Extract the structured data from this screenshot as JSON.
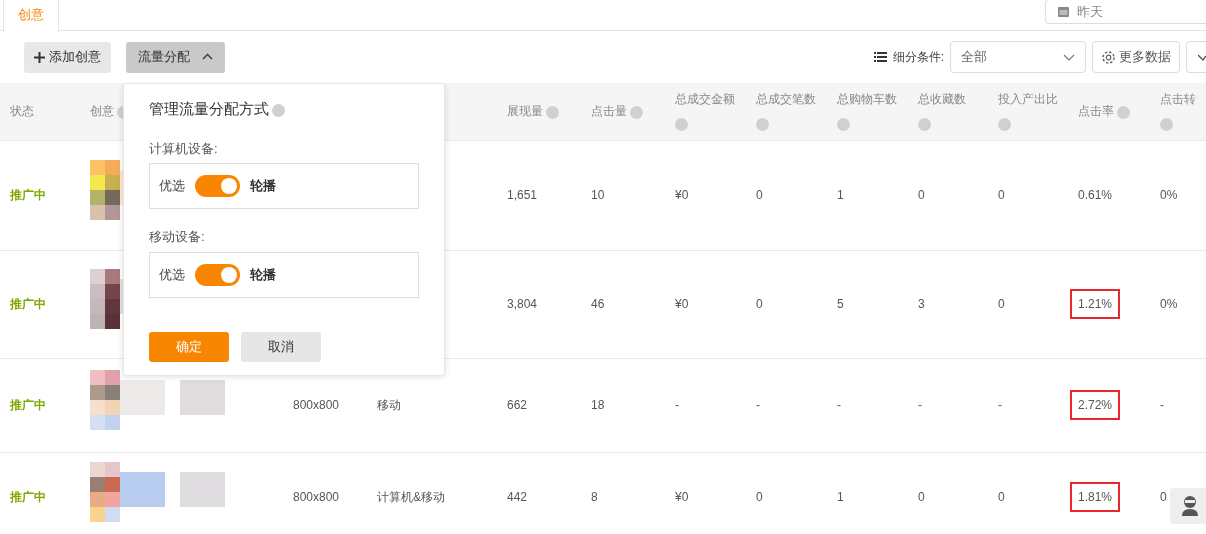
{
  "tabs": [
    {
      "label": "创意",
      "selected": true
    }
  ],
  "date_field": {
    "placeholder": "昨天"
  },
  "toolbar": {
    "add_button": "添加创意",
    "traffic_button": {
      "label": "流量分配",
      "expanded": true
    },
    "segment_label": "细分条件:",
    "segment_select": {
      "value": "全部"
    },
    "more_button": "更多数据"
  },
  "table": {
    "columns": [
      {
        "label": "状态",
        "help": false
      },
      {
        "label": "创意",
        "help": true
      },
      {},
      {},
      {
        "label": "展现量",
        "help": true
      },
      {
        "label": "点击量",
        "help": true
      },
      {
        "label": "总成交金额",
        "help": true
      },
      {
        "label": "总成交笔数",
        "help": true
      },
      {
        "label": "总购物车数",
        "help": true
      },
      {
        "label": "总收藏数",
        "help": true
      },
      {
        "label": "投入产出比",
        "help": true
      },
      {
        "label": "点击率",
        "help": true
      },
      {
        "label": "点击转",
        "help": true
      }
    ],
    "rows": [
      {
        "status": "推广中",
        "metrics": [
          {
            "value": "1,651",
            "highlighted": false
          },
          {
            "value": "10",
            "highlighted": false
          },
          {
            "value": "¥0",
            "highlighted": false
          },
          {
            "value": "0",
            "highlighted": false
          },
          {
            "value": "1",
            "highlighted": false
          },
          {
            "value": "0",
            "highlighted": false
          },
          {
            "value": "0",
            "highlighted": false
          },
          {
            "value": "0.61%",
            "highlighted": false
          },
          {
            "value": "0%",
            "highlighted": false
          }
        ]
      },
      {
        "status": "推广中",
        "metrics": [
          {
            "value": "3,804",
            "highlighted": false
          },
          {
            "value": "46",
            "highlighted": false
          },
          {
            "value": "¥0",
            "highlighted": false
          },
          {
            "value": "0",
            "highlighted": false
          },
          {
            "value": "5",
            "highlighted": false
          },
          {
            "value": "3",
            "highlighted": false
          },
          {
            "value": "0",
            "highlighted": false
          },
          {
            "value": "1.21%",
            "highlighted": true
          },
          {
            "value": "0%",
            "highlighted": false
          }
        ]
      },
      {
        "status": "推广中",
        "size": "800x800",
        "device": "移动",
        "metrics": [
          {
            "value": "662",
            "highlighted": false
          },
          {
            "value": "18",
            "highlighted": false
          },
          {
            "value": "-",
            "highlighted": false
          },
          {
            "value": "-",
            "highlighted": false
          },
          {
            "value": "-",
            "highlighted": false
          },
          {
            "value": "-",
            "highlighted": false
          },
          {
            "value": "-",
            "highlighted": false
          },
          {
            "value": "2.72%",
            "highlighted": true
          },
          {
            "value": "-",
            "highlighted": false
          }
        ]
      },
      {
        "status": "推广中",
        "size": "800x800",
        "device": "计算机&移动",
        "metrics": [
          {
            "value": "442",
            "highlighted": false
          },
          {
            "value": "8",
            "highlighted": false
          },
          {
            "value": "¥0",
            "highlighted": false
          },
          {
            "value": "0",
            "highlighted": false
          },
          {
            "value": "1",
            "highlighted": false
          },
          {
            "value": "0",
            "highlighted": false
          },
          {
            "value": "0",
            "highlighted": false
          },
          {
            "value": "1.81%",
            "highlighted": true
          },
          {
            "value": "0",
            "highlighted": false
          }
        ]
      }
    ]
  },
  "popup": {
    "title": "管理流量分配方式",
    "sections": [
      {
        "label": "计算机设备:",
        "left": "优选",
        "right": "轮播",
        "on": true
      },
      {
        "label": "移动设备:",
        "left": "优选",
        "right": "轮播",
        "on": true
      }
    ],
    "confirm": "确定",
    "cancel": "取消"
  }
}
